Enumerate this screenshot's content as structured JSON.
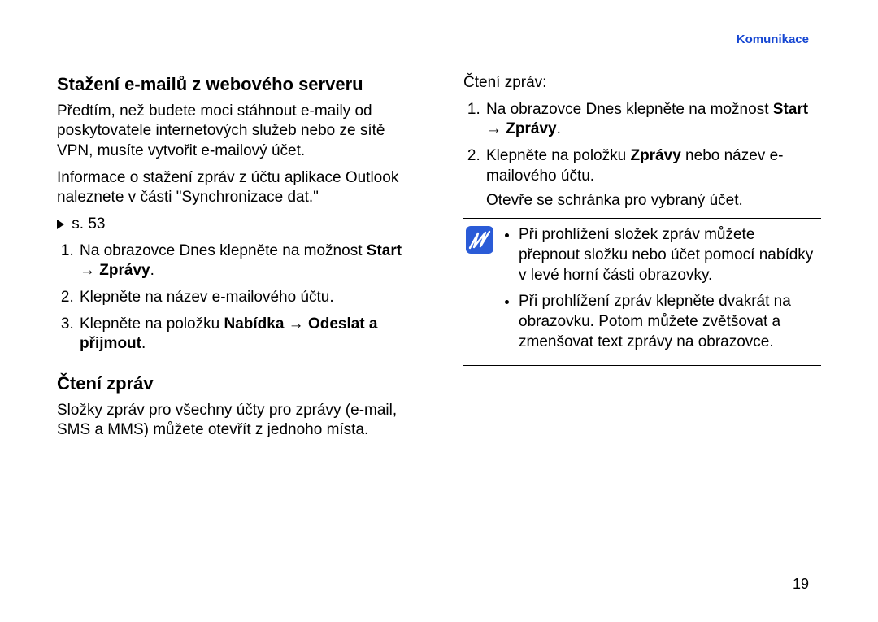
{
  "header": {
    "section": "Komunikace"
  },
  "left": {
    "heading1": "Stažení e-mailů z webového serveru",
    "intro1": "Předtím, než budete moci stáhnout e-maily od poskytovatele internetových služeb nebo ze sítě VPN, musíte vytvořit e-mailový účet.",
    "intro2": "Informace o stažení zpráv z účtu aplikace Outlook naleznete v části \"Synchronizace dat.\"",
    "ref": "s. 53",
    "steps1": {
      "s1a": "Na obrazovce Dnes klepněte na možnost ",
      "s1b": "Start → Zprávy",
      "s1c": ".",
      "s2": "Klepněte na název e-mailového účtu.",
      "s3a": "Klepněte na položku ",
      "s3b": "Nabídka → Odeslat a přijmout",
      "s3c": "."
    },
    "heading2": "Čtení zpráv",
    "para2": "Složky zpráv pro všechny účty pro zprávy (e-mail, SMS a MMS) můžete otevřít z jednoho místa."
  },
  "right": {
    "lead": "Čtení zpráv:",
    "steps": {
      "s1a": "Na obrazovce Dnes klepněte na možnost ",
      "s1b": "Start → Zprávy",
      "s1c": ".",
      "s2a": "Klepněte na položku ",
      "s2b": "Zprávy",
      "s2c": " nebo název e-mailového účtu.",
      "s2d": "Otevře se schránka pro vybraný účet."
    },
    "notes": {
      "n1": "Při prohlížení složek zpráv můžete přepnout složku nebo účet pomocí nabídky v levé horní části obrazovky.",
      "n2": "Při prohlížení zpráv klepněte dvakrát na obrazovku. Potom můžete zvětšovat a zmenšovat text zprávy na obrazovce."
    }
  },
  "page_number": "19"
}
